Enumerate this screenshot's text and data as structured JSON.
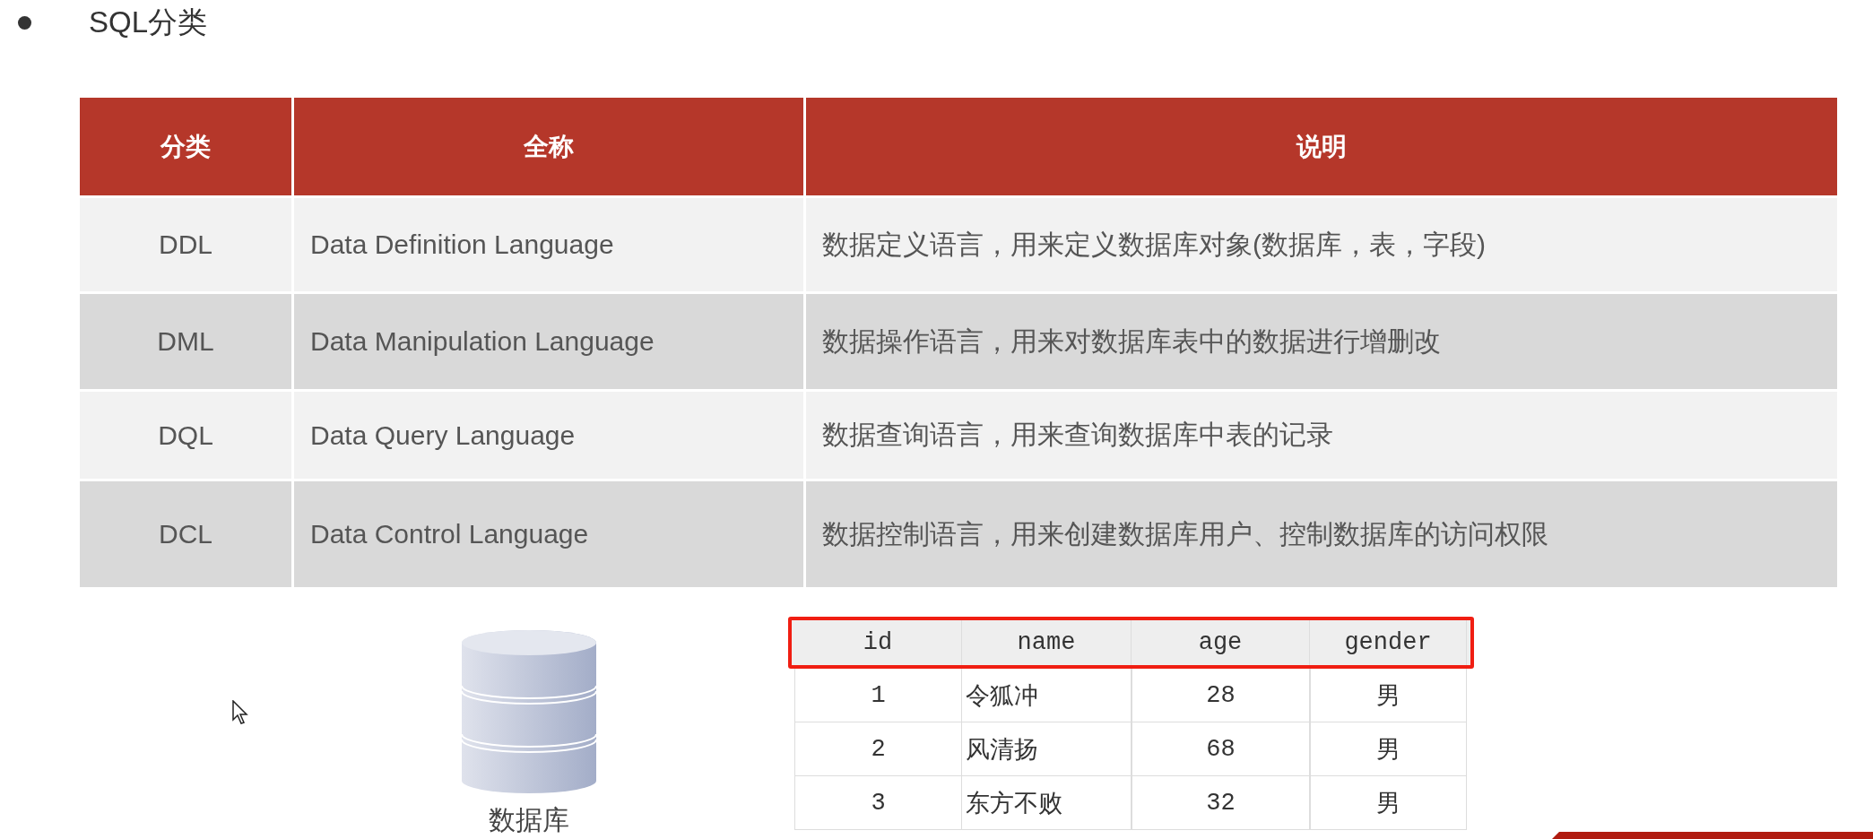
{
  "title": "SQL分类",
  "table": {
    "columns": [
      "分类",
      "全称",
      "说明"
    ],
    "rows": [
      {
        "cells": [
          "DDL",
          "Data Definition Language",
          "数据定义语言，用来定义数据库对象(数据库，表，字段)"
        ]
      },
      {
        "cells": [
          "DML",
          "Data Manipulation Language",
          "数据操作语言，用来对数据库表中的数据进行增删改"
        ]
      },
      {
        "cells": [
          "DQL",
          "Data Query Language",
          "数据查询语言，用来查询数据库中表的记录"
        ]
      },
      {
        "cells": [
          "DCL",
          "Data Control Language",
          "数据控制语言，用来创建数据库用户、控制数据库的访问权限"
        ]
      }
    ]
  },
  "database": {
    "label": "数据库"
  },
  "example_table": {
    "columns": [
      "id",
      "name",
      "age",
      "gender"
    ],
    "rows": [
      {
        "cells": [
          "1",
          "令狐冲",
          "28",
          "男"
        ]
      },
      {
        "cells": [
          "2",
          "风清扬",
          "68",
          "男"
        ]
      },
      {
        "cells": [
          "3",
          "东方不败",
          "32",
          "男"
        ]
      }
    ]
  }
}
